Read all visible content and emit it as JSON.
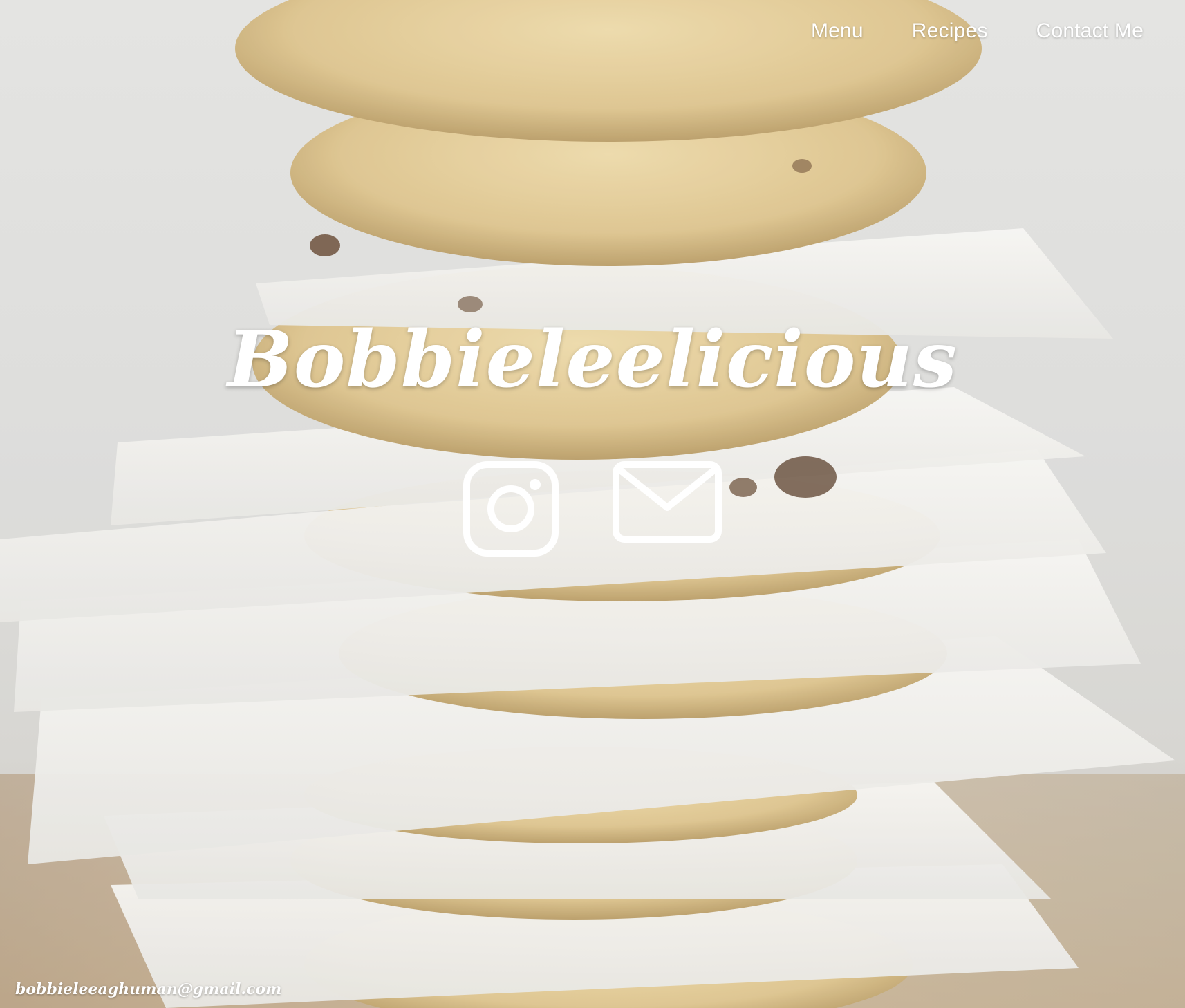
{
  "nav": {
    "items": [
      {
        "label": "Menu"
      },
      {
        "label": "Recipes"
      },
      {
        "label": "Contact Me"
      }
    ]
  },
  "hero": {
    "title": "Bobbieleelicious",
    "icons": [
      "instagram-icon",
      "mail-icon"
    ]
  },
  "footer": {
    "email": "bobbieleeaghuman@gmail.com"
  },
  "colors": {
    "text": "#ffffff",
    "cookie": "#e0c98f",
    "paper": "#f2f1ee"
  }
}
